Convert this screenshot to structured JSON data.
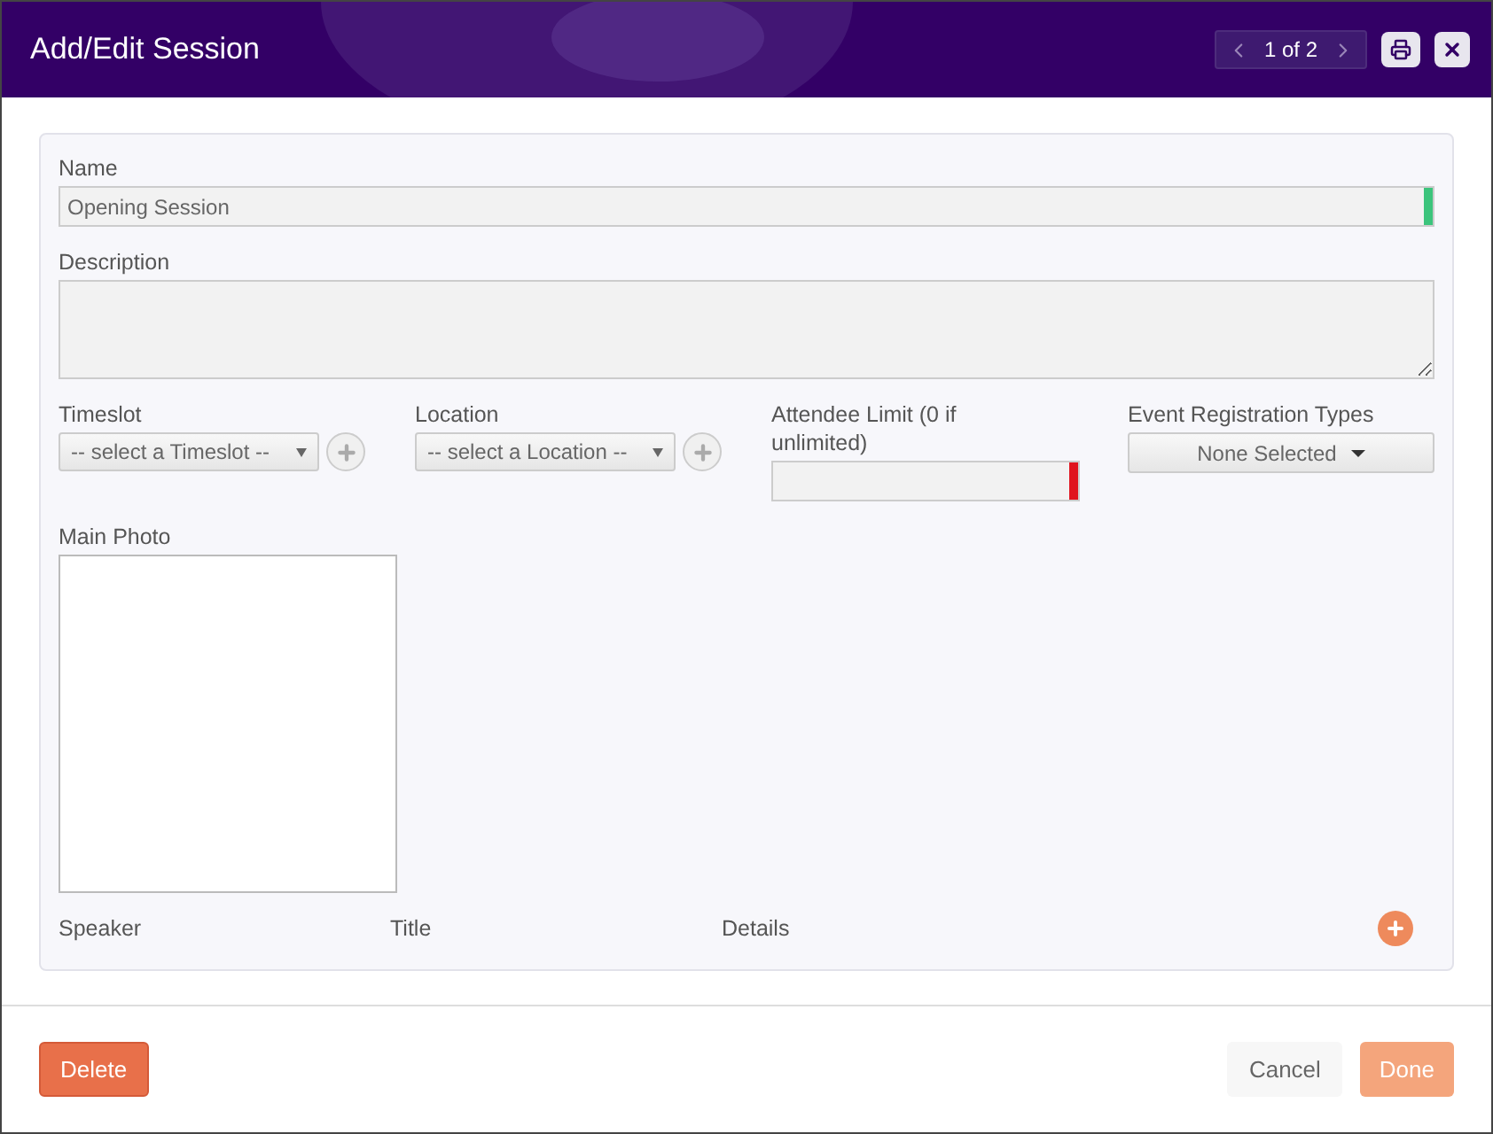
{
  "window": {
    "title": "Add/Edit Session",
    "pager": "1 of 2"
  },
  "name": {
    "label": "Name",
    "value": "Opening Session",
    "valid": true
  },
  "description": {
    "label": "Description"
  },
  "timeslot": {
    "label": "Timeslot",
    "value": "-- select a Timeslot --"
  },
  "location": {
    "label": "Location",
    "value": "-- select a Location --"
  },
  "attendee_limit": {
    "label": "Attendee Limit (0 if unlimited)",
    "valid": false
  },
  "registration_types": {
    "label": "Event Registration Types",
    "value": "None Selected"
  },
  "main_photo": {
    "label": "Main Photo"
  },
  "speakers": {
    "columns": [
      "Speaker",
      "Title",
      "Details"
    ]
  },
  "buttons": {
    "delete": "Delete",
    "cancel": "Cancel",
    "done": {
      "label": "Done",
      "disabled": true
    }
  }
}
